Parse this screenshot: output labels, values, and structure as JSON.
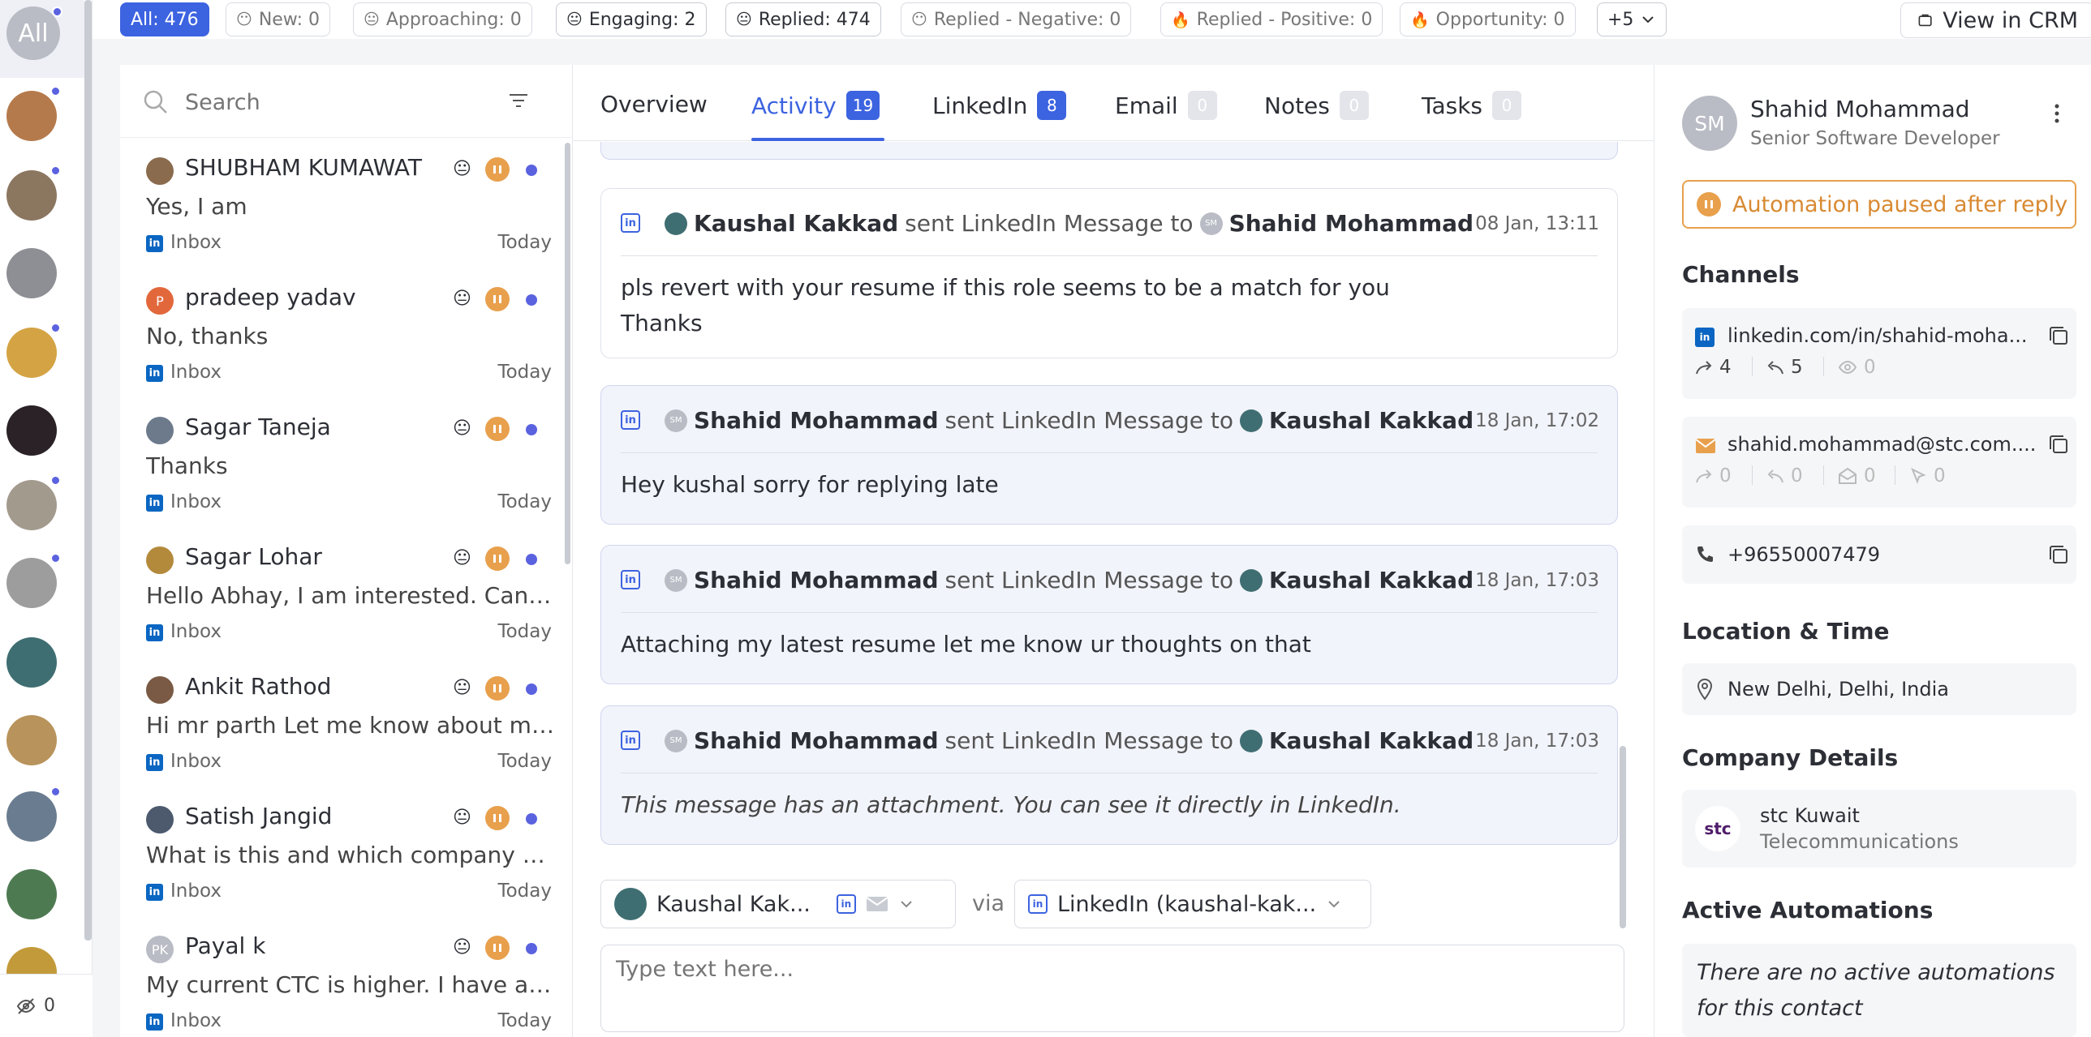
{
  "rail": {
    "all_label": "All",
    "hidden_count": "0"
  },
  "filters": [
    {
      "label": "All: 476",
      "active": true
    },
    {
      "label": "New: 0"
    },
    {
      "label": "Approaching: 0"
    },
    {
      "label": "Engaging: 2",
      "dark": true
    },
    {
      "label": "Replied: 474",
      "dark": true
    },
    {
      "label": "Replied - Negative: 0"
    },
    {
      "label": "Replied - Positive: 0"
    },
    {
      "label": "Opportunity: 0"
    },
    {
      "label": "+5",
      "dark": true
    }
  ],
  "view_crm": "View in CRM",
  "search": {
    "placeholder": "Search"
  },
  "conversations": [
    {
      "name": "SHUBHAM KUMAWAT",
      "message": "Yes, I am",
      "channel": "Inbox",
      "time": "Today",
      "avatar_color": "#8a6b4e",
      "initials": ""
    },
    {
      "name": "pradeep yadav",
      "message": "No, thanks",
      "channel": "Inbox",
      "time": "Today",
      "avatar_color": "#e2683c",
      "initials": "P"
    },
    {
      "name": "Sagar Taneja",
      "message": "Thanks",
      "channel": "Inbox",
      "time": "Today",
      "avatar_color": "#6c7a8c",
      "initials": ""
    },
    {
      "name": "Sagar Lohar",
      "message": "Hello Abhay, I am interested. Can y...",
      "channel": "Inbox",
      "time": "Today",
      "avatar_color": "#b38a3c",
      "initials": ""
    },
    {
      "name": "Ankit Rathod",
      "message": "Hi mr parth Let me know about mor...",
      "channel": "Inbox",
      "time": "Today",
      "avatar_color": "#7a5a44",
      "initials": ""
    },
    {
      "name": "Satish Jangid",
      "message": "What is this and which company an...",
      "channel": "Inbox",
      "time": "Today",
      "avatar_color": "#4d5a6e",
      "initials": ""
    },
    {
      "name": "Payal k",
      "message": "My current CTC is higher. I have a r...",
      "channel": "Inbox",
      "time": "Today",
      "avatar_color": "#b9bcc5",
      "initials": "PK"
    }
  ],
  "tabs": [
    {
      "label": "Overview",
      "count": ""
    },
    {
      "label": "Activity",
      "count": "19"
    },
    {
      "label": "LinkedIn",
      "count": "8"
    },
    {
      "label": "Email",
      "count": "0"
    },
    {
      "label": "Notes",
      "count": "0"
    },
    {
      "label": "Tasks",
      "count": "0"
    }
  ],
  "messages": [
    {
      "from": "Kaushal Kakkad",
      "verb": "sent LinkedIn Message to",
      "to": "Shahid Mohammad",
      "time": "08 Jan, 13:11",
      "body_line1": "pls revert with your resume if this role seems to be a match for you",
      "body_line2": "Thanks"
    },
    {
      "from": "Shahid Mohammad",
      "verb": "sent LinkedIn Message to",
      "to": "Kaushal Kakkad",
      "time": "18 Jan, 17:02",
      "body_line1": "Hey kushal sorry for replying late"
    },
    {
      "from": "Shahid Mohammad",
      "verb": "sent LinkedIn Message to",
      "to": "Kaushal Kakkad",
      "time": "18 Jan, 17:03",
      "body_line1": "Attaching my latest resume let me know ur thoughts on that"
    },
    {
      "from": "Shahid Mohammad",
      "verb": "sent LinkedIn Message to",
      "to": "Kaushal Kakkad",
      "time": "18 Jan, 17:03",
      "body_line1": "This message has an attachment. You can see it directly in LinkedIn."
    }
  ],
  "composer": {
    "sender": "Kaushal Kak...",
    "via": "via",
    "channel": "LinkedIn (kaushal-kak...",
    "placeholder": "Type text here..."
  },
  "contact": {
    "initials": "SM",
    "name": "Shahid Mohammad",
    "title": "Senior Software Developer",
    "automation_status": "Automation paused after reply",
    "channels_title": "Channels",
    "linkedin": "linkedin.com/in/shahid-moha...",
    "linkedin_sent": "4",
    "linkedin_replied": "5",
    "linkedin_viewed": "0",
    "email": "shahid.mohammad@stc.com....",
    "email_sent": "0",
    "email_replied": "0",
    "email_opened": "0",
    "email_clicked": "0",
    "phone": "+96550007479",
    "location_title": "Location & Time",
    "location": "New Delhi, Delhi, India",
    "company_title": "Company Details",
    "company_logo_text": "stc",
    "company_name": "stc Kuwait",
    "company_industry": "Telecommunications",
    "automations_title": "Active Automations",
    "automations_empty_line1": "There are no active automations",
    "automations_empty_line2": "for this contact"
  },
  "colors": {
    "accent": "#3c63e0",
    "unread_dot": "#5b62e0",
    "paused": "#e8a04c",
    "linkedin": "#0a66c2"
  }
}
